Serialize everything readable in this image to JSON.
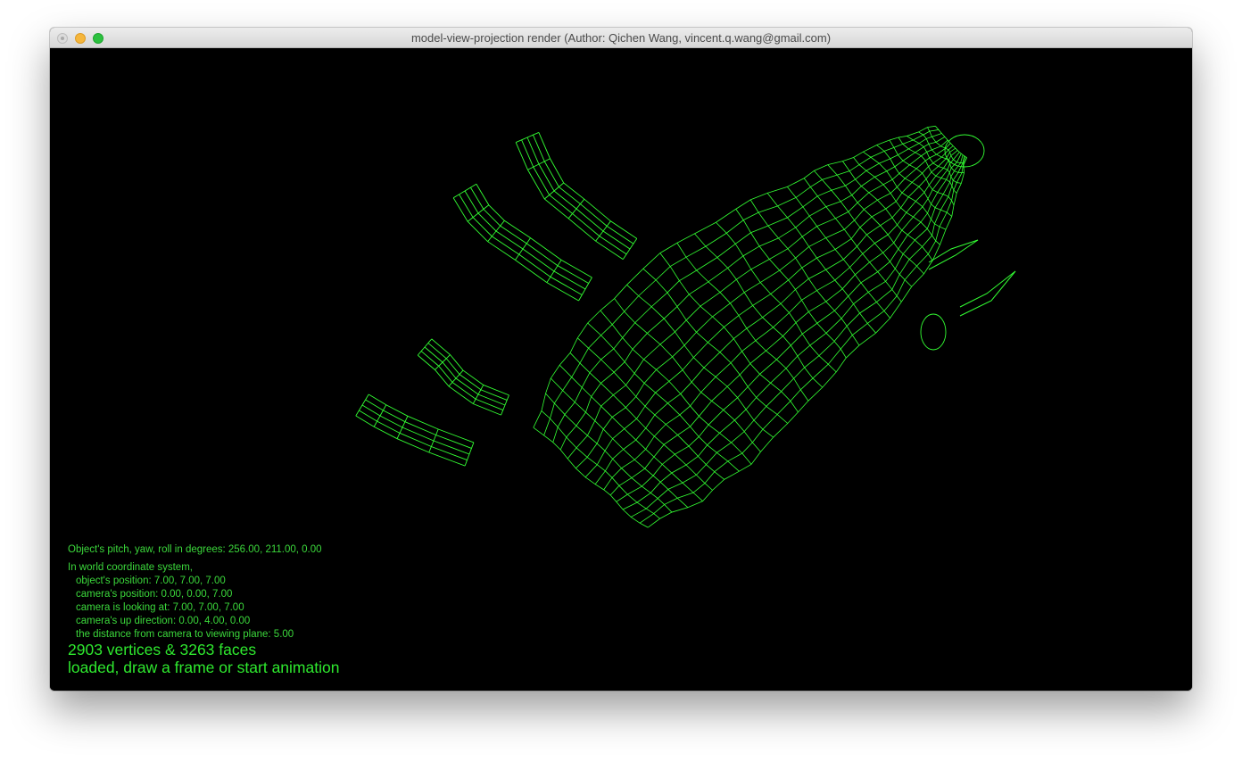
{
  "window": {
    "title": "model-view-projection render (Author: Qichen Wang, vincent.q.wang@gmail.com)",
    "background_color": "#000000",
    "wireframe_color": "#33ff33"
  },
  "info": {
    "orientation": "Object's pitch, yaw, roll in degrees: 256.00, 211.00, 0.00",
    "world_header": "In world coordinate system,",
    "object_position": "object's position: 7.00, 7.00, 7.00",
    "camera_position": "camera's position: 0.00, 0.00, 7.00",
    "camera_looking_at": "camera is looking at: 7.00, 7.00, 7.00",
    "camera_up": "camera's up direction: 0.00, 4.00, 0.00",
    "viewing_plane_distance": "the distance from camera to viewing plane: 5.00"
  },
  "status": {
    "counts": "2903 vertices & 3263 faces",
    "message": "loaded, draw a frame or start animation"
  }
}
